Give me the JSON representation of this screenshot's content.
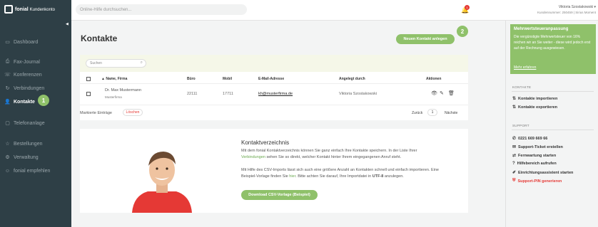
{
  "brand": {
    "name": "fonial",
    "product": "Kundenkonto"
  },
  "topbar": {
    "search_placeholder": "Online-Hilfe durchsuchen...",
    "notification_count": "1",
    "user_name": "Viktoria Szostakowski",
    "customer_number": "Kundennummer: 250459 | Sirius Moment"
  },
  "sidebar": {
    "items": [
      {
        "label": "Dashboard",
        "icon": "dashboard-icon"
      },
      {
        "label": "Fax-Journal",
        "icon": "fax-icon"
      },
      {
        "label": "Konferenzen",
        "icon": "conference-icon"
      },
      {
        "label": "Verbindungen",
        "icon": "connections-icon"
      },
      {
        "label": "Kontakte",
        "icon": "contacts-icon",
        "active": true
      },
      {
        "label": "Telefonanlage",
        "icon": "phone-system-icon"
      },
      {
        "label": "Bestellungen",
        "icon": "orders-icon"
      },
      {
        "label": "Verwaltung",
        "icon": "admin-icon"
      },
      {
        "label": "fonial empfehlen",
        "icon": "recommend-icon"
      }
    ],
    "step_badge": "1"
  },
  "main": {
    "title": "Kontakte",
    "new_contact_button": "Neuen Kontakt anlegen",
    "step_badge": "2",
    "table": {
      "search_placeholder": "Suchen",
      "columns": [
        "Name, Firma",
        "Büro",
        "Mobil",
        "E-Mail-Adresse",
        "Angelegt durch",
        "Aktionen"
      ],
      "rows": [
        {
          "name": "Dr. Max Mustermann",
          "company": "Musterfirma",
          "office": "22111",
          "mobile": "17711",
          "email": "kh@musterfirma.de",
          "created_by": "Viktoria Szostakowski"
        }
      ]
    },
    "marked_label": "Markierte Einträge",
    "delete_label": "Löschen",
    "pagination": {
      "back": "Zurück",
      "page": "1",
      "next": "Nächste"
    },
    "info": {
      "title": "Kontaktverzeichnis",
      "p1_a": "Mit dem fonial Kontaktverzeichnis können Sie ganz einfach Ihre Kontakte speichern. In der Liste Ihrer",
      "p1_link": "Verbindungen",
      "p1_b": "sehen Sie so direkt, welcher Kontakt hinter Ihrem eingegangenen Anruf steht.",
      "p2_a": "Mit Hilfe des CSV-Imports lässt sich auch eine größere Anzahl an Kontakten schnell und einfach importieren. Eine",
      "p2_b": "Beispiel-Vorlage finden Sie",
      "p2_link": "hier",
      "p2_c": ". Bitte achten Sie darauf, Ihre Importdatei in",
      "p2_bold": "UTF-8",
      "p2_d": "anzulegen.",
      "download_button": "Download CSV-Vorlage (Beispiel)"
    }
  },
  "rail": {
    "promo": {
      "title": "Mehrwertsteueranpassung",
      "text": "Die vergünstigte Mehrwertsteuer von 16% reichen wir an Sie weiter - diese wird jedoch erst auf der Rechnung ausgewiesen.",
      "link": "Mehr erfahren"
    },
    "contacts_heading": "KONTAKTE",
    "contacts_items": [
      {
        "label": "Kontakte importieren",
        "icon": "import-icon"
      },
      {
        "label": "Kontakte exportieren",
        "icon": "export-icon"
      }
    ],
    "support_heading": "SUPPORT",
    "support_items": [
      {
        "label": "0221 669 669 66",
        "icon": "phone-icon"
      },
      {
        "label": "Support-Ticket erstellen",
        "icon": "ticket-icon"
      },
      {
        "label": "Fernwartung starten",
        "icon": "remote-icon"
      },
      {
        "label": "Hilfebereich aufrufen",
        "icon": "help-icon"
      },
      {
        "label": "Einrichtungsassistent starten",
        "icon": "wizard-icon"
      },
      {
        "label": "Support-PIN generieren",
        "icon": "pin-icon",
        "red": true
      }
    ]
  },
  "colors": {
    "sidebar": "#2e3f46",
    "accent": "#8fc16a",
    "danger": "#e53935"
  }
}
